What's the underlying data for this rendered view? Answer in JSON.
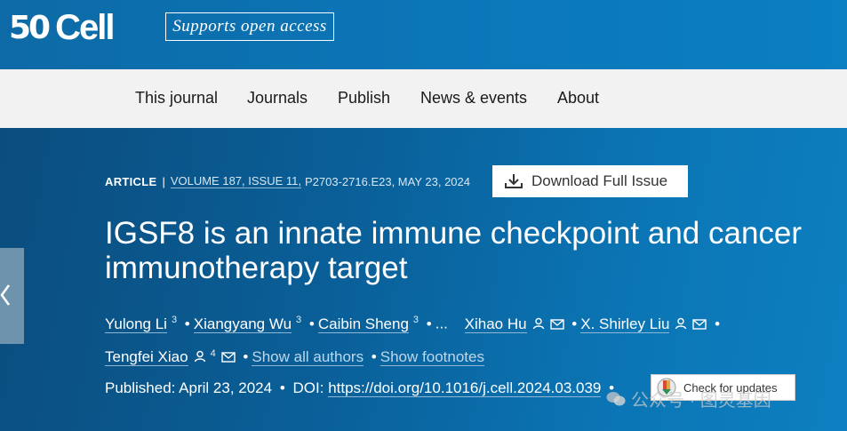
{
  "header": {
    "logo_number": "50",
    "logo_text": "Cell",
    "open_access_badge": "Supports open access"
  },
  "nav": {
    "items": [
      {
        "label": "This journal"
      },
      {
        "label": "Journals"
      },
      {
        "label": "Publish"
      },
      {
        "label": "News & events"
      },
      {
        "label": "About"
      }
    ]
  },
  "article": {
    "type": "ARTICLE",
    "separator": "|",
    "volume_issue": "VOLUME 187, ISSUE 11,",
    "pages_date": "P2703-2716.E23, MAY 23, 2024",
    "download_label": "Download Full Issue",
    "title": "IGSF8 is an innate immune checkpoint and cancer immunotherapy target",
    "authors": [
      {
        "name": "Yulong Li",
        "sup": "3"
      },
      {
        "name": "Xiangyang Wu",
        "sup": "3"
      },
      {
        "name": "Caibin Sheng",
        "sup": "3"
      },
      {
        "name": "Xihao Hu"
      },
      {
        "name": "X. Shirley Liu"
      },
      {
        "name": "Tengfei Xiao",
        "sup": "4"
      }
    ],
    "ellipsis": "...",
    "show_all_authors": "Show all authors",
    "show_footnotes": "Show footnotes",
    "published_label": "Published: April 23, 2024",
    "doi_label": "DOI:",
    "doi_url": "https://doi.org/10.1016/j.cell.2024.03.039",
    "check_updates_label": "Check for updates"
  },
  "watermark": {
    "text": "公众号 · 图灵基因"
  },
  "colors": {
    "brand_blue": "#0b76b6",
    "nav_bg": "#f2f2f2"
  }
}
